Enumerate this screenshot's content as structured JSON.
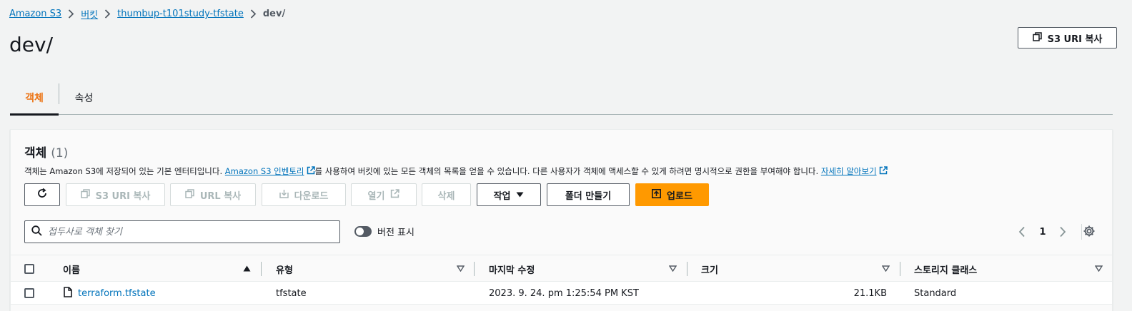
{
  "breadcrumb": {
    "items": [
      "Amazon S3",
      "버킷",
      "thumbup-t101study-tfstate"
    ],
    "current": "dev/"
  },
  "page": {
    "title": "dev/",
    "copy_s3_uri": "S3 URI 복사"
  },
  "tabs": [
    {
      "label": "객체",
      "active": true
    },
    {
      "label": "속성",
      "active": false
    }
  ],
  "objects_panel": {
    "title": "객체",
    "count": "(1)",
    "description_prefix": "객체는 Amazon S3에 저장되어 있는 기본 엔터티입니다.",
    "inventory_link": "Amazon S3 인벤토리",
    "description_middle": "를 사용하여 버킷에 있는 모든 객체의 목록을 얻을 수 있습니다. 다른 사용자가 객체에 액세스할 수 있게 하려면 명시적으로 권한을 부여해야 합니다.",
    "learn_more_link": "자세히 알아보기"
  },
  "toolbar": {
    "refresh_icon": "refresh-icon",
    "copy_s3_uri": "S3 URI 복사",
    "copy_url": "URL 복사",
    "download": "다운로드",
    "open": "열기",
    "delete": "삭제",
    "actions": "작업",
    "create_folder": "폴더 만들기",
    "upload": "업로드"
  },
  "search": {
    "placeholder": "접두사로 객체 찾기",
    "value": ""
  },
  "versions_toggle": {
    "label": "버전 표시",
    "on": false
  },
  "pagination": {
    "current_page": "1"
  },
  "table": {
    "columns": [
      "이름",
      "유형",
      "마지막 수정",
      "크기",
      "스토리지 클래스"
    ],
    "rows": [
      {
        "name": "terraform.tfstate",
        "type": "tfstate",
        "last_modified": "2023. 9. 24. pm 1:25:54 PM KST",
        "size": "21.1KB",
        "storage_class": "Standard"
      }
    ]
  },
  "colors": {
    "link": "#0073bb",
    "active_tab": "#ec7211",
    "primary_button": "#ff9900",
    "background": "#f2f3f3"
  }
}
